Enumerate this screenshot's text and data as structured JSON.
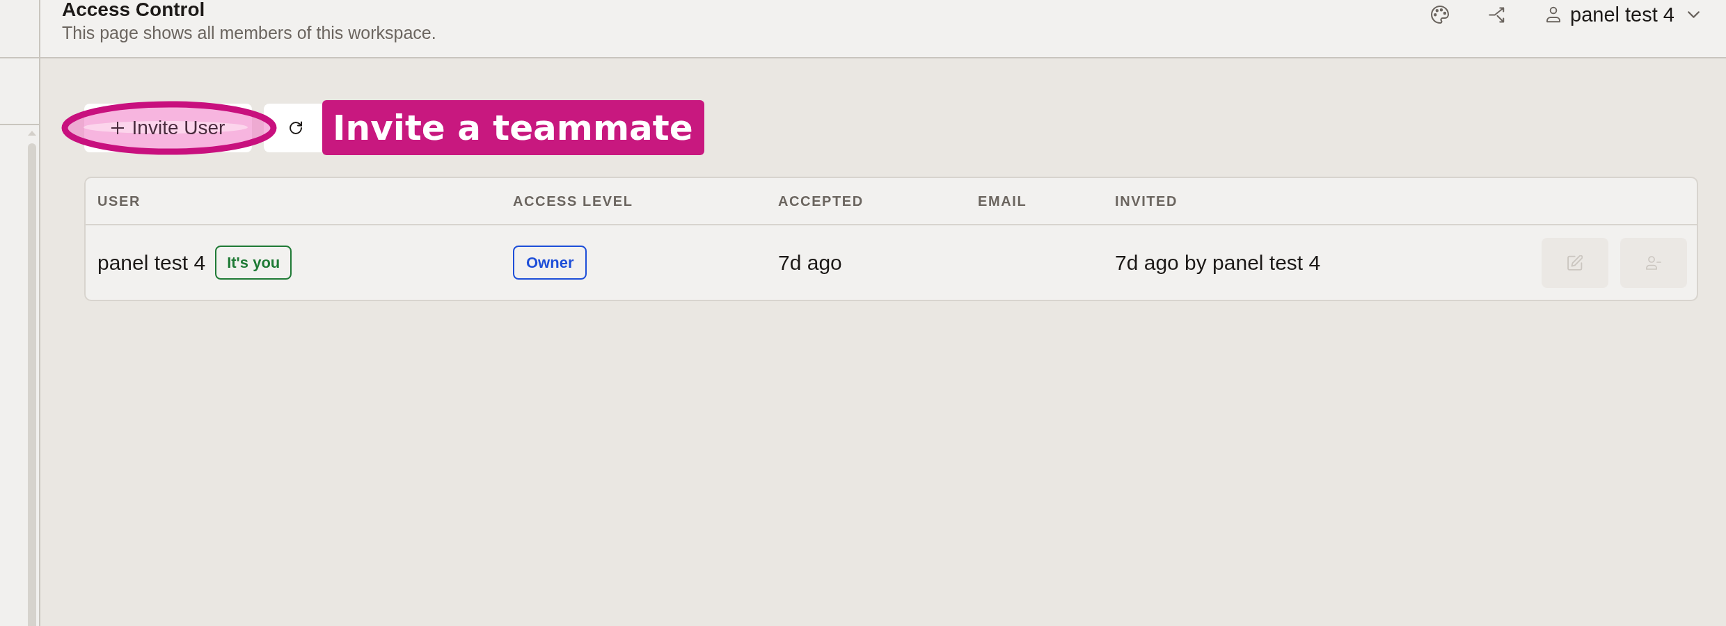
{
  "header": {
    "title": "Access Control",
    "subtitle": "This page shows all members of this workspace.",
    "account": {
      "name": "panel test 4"
    }
  },
  "toolbar": {
    "invite_button": {
      "label": "Invite User"
    }
  },
  "callout": {
    "text": "Invite a teammate"
  },
  "table": {
    "columns": [
      "USER",
      "ACCESS LEVEL",
      "ACCEPTED",
      "EMAIL",
      "INVITED"
    ],
    "rows": [
      {
        "user": "panel test 4",
        "you_badge": "It's you",
        "access_level": "Owner",
        "accepted": "7d ago",
        "invited": "7d ago by panel test 4",
        "actions": [
          {
            "kind": "edit",
            "disabled": true
          },
          {
            "kind": "remove",
            "disabled": true
          }
        ]
      }
    ]
  }
}
